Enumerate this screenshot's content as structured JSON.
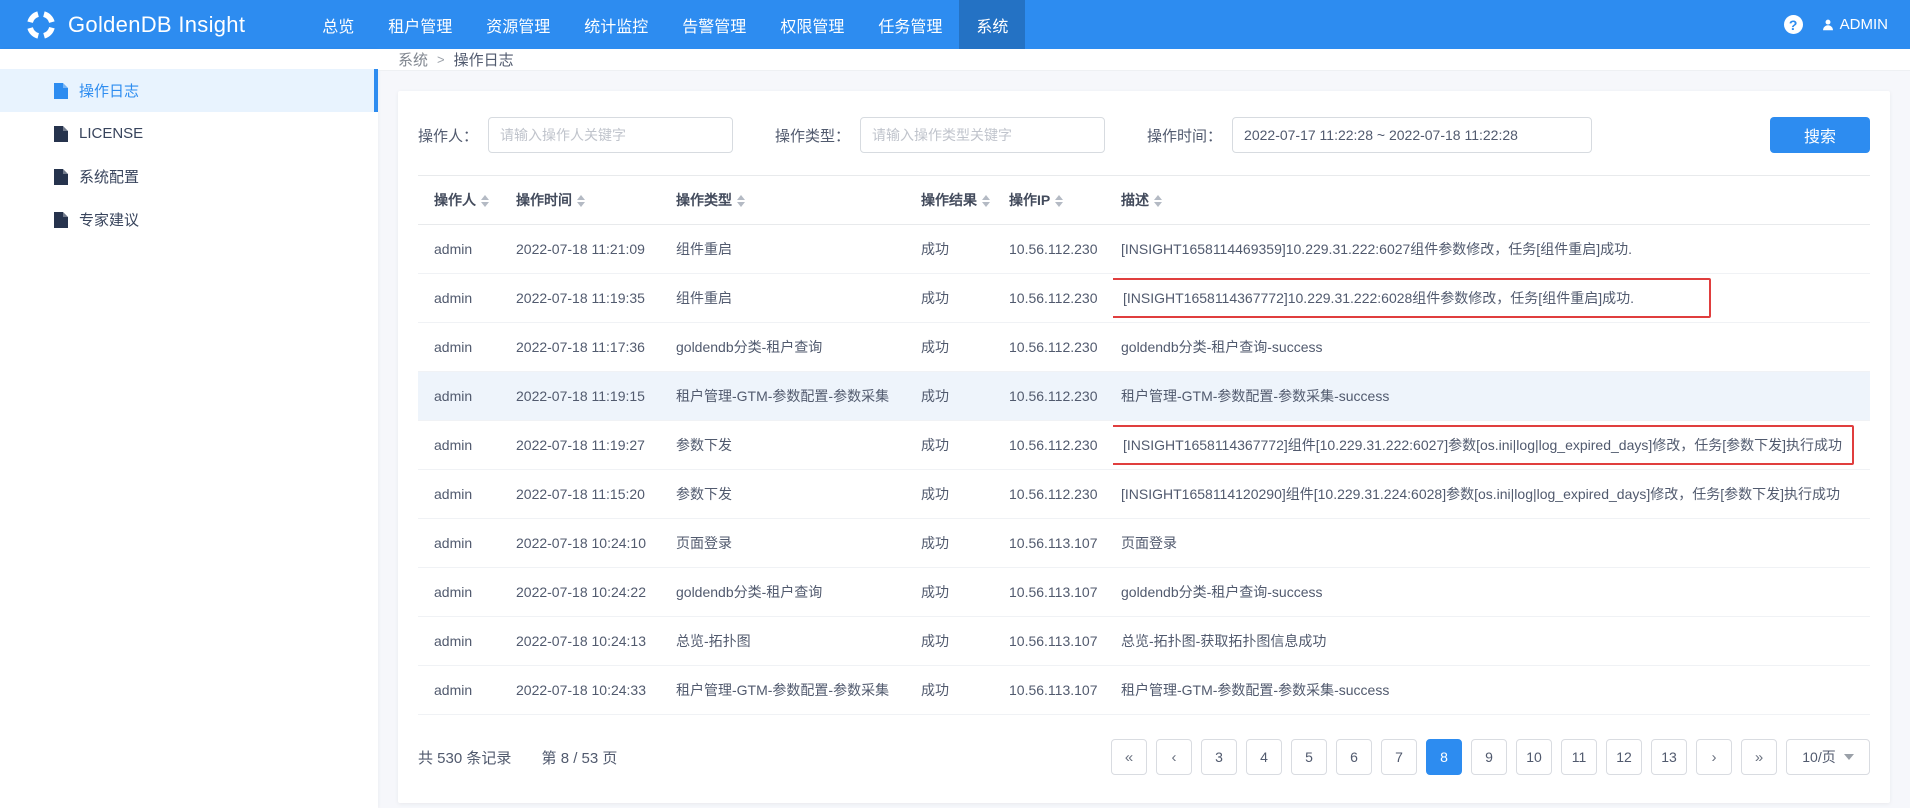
{
  "colors": {
    "accent": "#2d8cf0",
    "highlight_row": "#eef4fb",
    "red_box_border": "#e03e3e"
  },
  "header": {
    "brand": "GoldenDB Insight",
    "user": "ADMIN",
    "nav_items": [
      {
        "id": "overview",
        "label": "总览",
        "active": false
      },
      {
        "id": "tenant-mgmt",
        "label": "租户管理",
        "active": false
      },
      {
        "id": "resource-mgmt",
        "label": "资源管理",
        "active": false
      },
      {
        "id": "stats-monitor",
        "label": "统计监控",
        "active": false
      },
      {
        "id": "alarm-mgmt",
        "label": "告警管理",
        "active": false
      },
      {
        "id": "permission-mgmt",
        "label": "权限管理",
        "active": false
      },
      {
        "id": "task-mgmt",
        "label": "任务管理",
        "active": false
      },
      {
        "id": "system",
        "label": "系统",
        "active": true
      }
    ]
  },
  "sidebar": {
    "items": [
      {
        "id": "operation-log",
        "label": "操作日志",
        "active": true
      },
      {
        "id": "license",
        "label": "LICENSE",
        "active": false
      },
      {
        "id": "system-config",
        "label": "系统配置",
        "active": false
      },
      {
        "id": "expert-advice",
        "label": "专家建议",
        "active": false
      }
    ]
  },
  "breadcrumb": {
    "items": [
      "系统",
      "操作日志"
    ]
  },
  "filters": {
    "operator_label": "操作人：",
    "operator_placeholder": "请输入操作人关键字",
    "type_label": "操作类型：",
    "type_placeholder": "请输入操作类型关键字",
    "time_label": "操作时间：",
    "time_value": "2022-07-17 11:22:28 ~ 2022-07-18 11:22:28",
    "search_label": "搜索"
  },
  "table": {
    "columns": [
      {
        "id": "operator",
        "label": "操作人"
      },
      {
        "id": "time",
        "label": "操作时间"
      },
      {
        "id": "type",
        "label": "操作类型"
      },
      {
        "id": "result",
        "label": "操作结果"
      },
      {
        "id": "ip",
        "label": "操作IP"
      },
      {
        "id": "desc",
        "label": "描述"
      }
    ],
    "rows": [
      {
        "operator": "admin",
        "time": "2022-07-18 11:21:09",
        "type": "组件重启",
        "result": "成功",
        "ip": "10.56.112.230",
        "desc": "[INSIGHT1658114469359]10.229.31.222:6027组件参数修改，任务[组件重启]成功.",
        "highlight": false,
        "red_box": false
      },
      {
        "operator": "admin",
        "time": "2022-07-18 11:19:35",
        "type": "组件重启",
        "result": "成功",
        "ip": "10.56.112.230",
        "desc": "[INSIGHT1658114367772]10.229.31.222:6028组件参数修改，任务[组件重启]成功.",
        "highlight": false,
        "red_box": true,
        "red_box_min_width": 600
      },
      {
        "operator": "admin",
        "time": "2022-07-18 11:17:36",
        "type": "goldendb分类-租户查询",
        "result": "成功",
        "ip": "10.56.112.230",
        "desc": "goldendb分类-租户查询-success",
        "highlight": false,
        "red_box": false
      },
      {
        "operator": "admin",
        "time": "2022-07-18 11:19:15",
        "type": "租户管理-GTM-参数配置-参数采集",
        "result": "成功",
        "ip": "10.56.112.230",
        "desc": "租户管理-GTM-参数配置-参数采集-success",
        "highlight": true,
        "red_box": false
      },
      {
        "operator": "admin",
        "time": "2022-07-18 11:19:27",
        "type": "参数下发",
        "result": "成功",
        "ip": "10.56.112.230",
        "desc": "[INSIGHT1658114367772]组件[10.229.31.222:6027]参数[os.ini|log|log_expired_days]修改，任务[参数下发]执行成功",
        "highlight": false,
        "red_box": true
      },
      {
        "operator": "admin",
        "time": "2022-07-18 11:15:20",
        "type": "参数下发",
        "result": "成功",
        "ip": "10.56.112.230",
        "desc": "[INSIGHT1658114120290]组件[10.229.31.224:6028]参数[os.ini|log|log_expired_days]修改，任务[参数下发]执行成功",
        "highlight": false,
        "red_box": false
      },
      {
        "operator": "admin",
        "time": "2022-07-18 10:24:10",
        "type": "页面登录",
        "result": "成功",
        "ip": "10.56.113.107",
        "desc": "页面登录",
        "highlight": false,
        "red_box": false
      },
      {
        "operator": "admin",
        "time": "2022-07-18 10:24:22",
        "type": "goldendb分类-租户查询",
        "result": "成功",
        "ip": "10.56.113.107",
        "desc": "goldendb分类-租户查询-success",
        "highlight": false,
        "red_box": false
      },
      {
        "operator": "admin",
        "time": "2022-07-18 10:24:13",
        "type": "总览-拓扑图",
        "result": "成功",
        "ip": "10.56.113.107",
        "desc": "总览-拓扑图-获取拓扑图信息成功",
        "highlight": false,
        "red_box": false
      },
      {
        "operator": "admin",
        "time": "2022-07-18 10:24:33",
        "type": "租户管理-GTM-参数配置-参数采集",
        "result": "成功",
        "ip": "10.56.113.107",
        "desc": "租户管理-GTM-参数配置-参数采集-success",
        "highlight": false,
        "red_box": false
      }
    ]
  },
  "pagination": {
    "total_text": "共 530 条记录",
    "page_text": "第 8 / 53 页",
    "active_page": "8",
    "items": [
      {
        "id": "jump-prev",
        "label": "«",
        "arrow": true
      },
      {
        "id": "prev",
        "label": "‹",
        "arrow": true
      },
      {
        "label": "3"
      },
      {
        "label": "4"
      },
      {
        "label": "5"
      },
      {
        "label": "6"
      },
      {
        "label": "7"
      },
      {
        "label": "8"
      },
      {
        "label": "9"
      },
      {
        "label": "10"
      },
      {
        "label": "11"
      },
      {
        "label": "12"
      },
      {
        "label": "13"
      },
      {
        "id": "next",
        "label": "›",
        "arrow": true
      },
      {
        "id": "jump-next",
        "label": "»",
        "arrow": true
      }
    ],
    "page_size": "10/页"
  }
}
